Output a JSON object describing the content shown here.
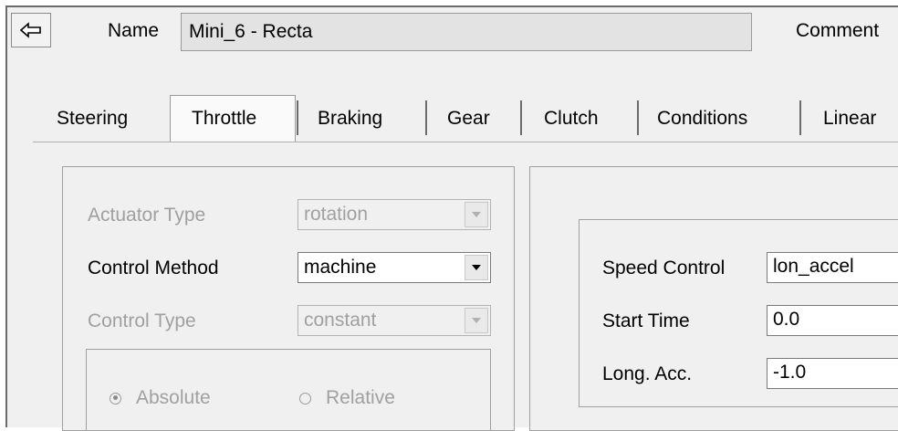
{
  "header": {
    "name_label": "Name",
    "name_value": "Mini_6 - Recta",
    "comment_label": "Comment"
  },
  "tabs": [
    {
      "label": "Steering"
    },
    {
      "label": "Throttle",
      "active": true
    },
    {
      "label": "Braking"
    },
    {
      "label": "Gear"
    },
    {
      "label": "Clutch"
    },
    {
      "label": "Conditions"
    },
    {
      "label": "Linear"
    }
  ],
  "throttle": {
    "actuator_type_label": "Actuator Type",
    "actuator_type_value": "rotation",
    "control_method_label": "Control Method",
    "control_method_value": "machine",
    "control_type_label": "Control Type",
    "control_type_value": "constant",
    "radio_absolute": "Absolute",
    "radio_relative": "Relative",
    "selected_mode": "Absolute"
  },
  "speed": {
    "speed_control_label": "Speed Control",
    "speed_control_value": "lon_accel",
    "start_time_label": "Start Time",
    "start_time_value": "0.0",
    "long_acc_label": "Long. Acc.",
    "long_acc_value": "-1.0"
  },
  "icons": {
    "back": "back-arrow-icon",
    "dropdown": "chevron-down-icon"
  }
}
